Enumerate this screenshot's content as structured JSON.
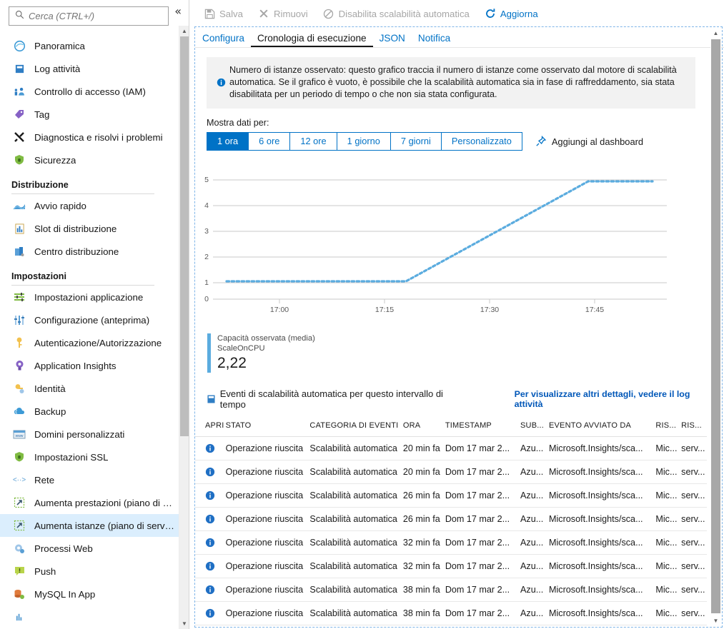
{
  "sidebar": {
    "search": {
      "placeholder": "Cerca (CTRL+/)",
      "value": "",
      "icon": "search-icon"
    },
    "collapse_label": "«",
    "items": [
      {
        "label": "Panoramica",
        "icon": "overview-icon",
        "selected": false
      },
      {
        "label": "Log attività",
        "icon": "activity-log-icon",
        "selected": false
      },
      {
        "label": "Controllo di accesso (IAM)",
        "icon": "access-control-icon",
        "selected": false
      },
      {
        "label": "Tag",
        "icon": "tag-icon",
        "selected": false
      },
      {
        "label": "Diagnostica e risolvi i problemi",
        "icon": "diagnose-icon",
        "selected": false
      },
      {
        "label": "Sicurezza",
        "icon": "security-shield-icon",
        "selected": false
      }
    ],
    "groups": [
      {
        "title": "Distribuzione",
        "items": [
          {
            "label": "Avvio rapido",
            "icon": "quickstart-icon",
            "selected": false
          },
          {
            "label": "Slot di distribuzione",
            "icon": "deployment-slots-icon",
            "selected": false
          },
          {
            "label": "Centro distribuzione",
            "icon": "deployment-center-icon",
            "selected": false
          }
        ]
      },
      {
        "title": "Impostazioni",
        "items": [
          {
            "label": "Impostazioni applicazione",
            "icon": "app-settings-icon",
            "selected": false
          },
          {
            "label": "Configurazione (anteprima)",
            "icon": "configuration-icon",
            "selected": false
          },
          {
            "label": "Autenticazione/Autorizzazione",
            "icon": "auth-key-icon",
            "selected": false
          },
          {
            "label": "Application Insights",
            "icon": "app-insights-icon",
            "selected": false
          },
          {
            "label": "Identità",
            "icon": "identity-key-icon",
            "selected": false
          },
          {
            "label": "Backup",
            "icon": "backup-cloud-icon",
            "selected": false
          },
          {
            "label": "Domini personalizzati",
            "icon": "custom-domains-icon",
            "selected": false
          },
          {
            "label": "Impostazioni SSL",
            "icon": "ssl-shield-icon",
            "selected": false
          },
          {
            "label": "Rete",
            "icon": "network-icon",
            "selected": false
          },
          {
            "label": "Aumenta prestazioni (piano di s...",
            "icon": "scale-up-icon",
            "selected": false
          },
          {
            "label": "Aumenta istanze (piano di servi...",
            "icon": "scale-out-icon",
            "selected": true
          },
          {
            "label": "Processi Web",
            "icon": "webjobs-icon",
            "selected": false
          },
          {
            "label": "Push",
            "icon": "push-icon",
            "selected": false
          },
          {
            "label": "MySQL In App",
            "icon": "mysql-icon",
            "selected": false
          }
        ]
      }
    ],
    "scrollbar": {
      "up_arrow": "▲",
      "down_arrow": "▼"
    }
  },
  "toolbar": {
    "items": [
      {
        "label": "Salva",
        "icon": "save-icon",
        "enabled": false
      },
      {
        "label": "Rimuovi",
        "icon": "discard-x-icon",
        "enabled": false
      },
      {
        "label": "Disabilita scalabilità automatica",
        "icon": "disable-circle-icon",
        "enabled": false
      },
      {
        "label": "Aggiorna",
        "icon": "refresh-icon",
        "enabled": true
      }
    ]
  },
  "tabs": [
    {
      "label": "Configura",
      "active": false
    },
    {
      "label": "Cronologia di esecuzione",
      "active": true
    },
    {
      "label": "JSON",
      "active": false
    },
    {
      "label": "Notifica",
      "active": false
    }
  ],
  "info_banner": {
    "icon": "info-icon",
    "text": "Numero di istanze osservato: questo grafico traccia il numero di istanze come osservato dal motore di scalabilità automatica. Se il grafico è vuoto, è possibile che la scalabilità automatica sia in fase di raffreddamento, sia stata disabilitata per un periodo di tempo o che non sia stata configurata."
  },
  "time_range": {
    "label": "Mostra dati per:",
    "options": [
      {
        "label": "1 ora",
        "active": true
      },
      {
        "label": "6 ore",
        "active": false
      },
      {
        "label": "12 ore",
        "active": false
      },
      {
        "label": "1 giorno",
        "active": false
      },
      {
        "label": "7 giorni",
        "active": false
      },
      {
        "label": "Personalizzato",
        "active": false
      }
    ],
    "pin": {
      "label": "Aggiungi al dashboard",
      "icon": "pin-icon"
    }
  },
  "chart_data": {
    "type": "line",
    "title": "",
    "xlabel": "",
    "ylabel": "",
    "ylim": [
      0,
      5
    ],
    "yticks": [
      0,
      1,
      2,
      3,
      4,
      5
    ],
    "xticks": [
      "17:00",
      "17:15",
      "17:30",
      "17:45"
    ],
    "grid": true,
    "legend_position": "below",
    "line_style": "dotted",
    "color": "#5bacdf",
    "series": [
      {
        "name": "Capacità osservata (media) ScaleOnCPU",
        "x": [
          "16:55",
          "17:00",
          "17:05",
          "17:10",
          "17:15",
          "17:18",
          "17:20",
          "17:25",
          "17:30",
          "17:35",
          "17:40",
          "17:43",
          "17:45",
          "17:50",
          "17:55"
        ],
        "values": [
          1,
          1,
          1,
          1,
          1,
          1,
          1.6,
          2.4,
          3.0,
          3.8,
          4.6,
          5,
          5,
          5,
          5
        ]
      }
    ],
    "legend": {
      "metric_label": "Capacità osservata (media)",
      "resource_label": "ScaleOnCPU",
      "value": "2,22",
      "color": "#5bacdf"
    }
  },
  "events": {
    "icon": "events-icon",
    "title": "Eventi di scalabilità automatica per questo intervallo di tempo",
    "link": "Per visualizzare altri dettagli, vedere il log attività",
    "columns": [
      "APRI",
      "STATO",
      "CATEGORIA DI EVENTI",
      "ORA",
      "TIMESTAMP",
      "SUB...",
      "EVENTO AVVIATO DA",
      "RIS...",
      "RIS..."
    ],
    "rows": [
      {
        "apri": "info-icon",
        "stato": "Operazione riuscita",
        "categoria": "Scalabilità automatica",
        "ora": "20 min fa",
        "timestamp": "Dom 17 mar 2...",
        "sub": "Azu...",
        "evento": "Microsoft.Insights/sca...",
        "ris1": "Mic...",
        "ris2": "serv..."
      },
      {
        "apri": "info-icon",
        "stato": "Operazione riuscita",
        "categoria": "Scalabilità automatica",
        "ora": "20 min fa",
        "timestamp": "Dom 17 mar 2...",
        "sub": "Azu...",
        "evento": "Microsoft.Insights/sca...",
        "ris1": "Mic...",
        "ris2": "serv..."
      },
      {
        "apri": "info-icon",
        "stato": "Operazione riuscita",
        "categoria": "Scalabilità automatica",
        "ora": "26 min fa",
        "timestamp": "Dom 17 mar 2...",
        "sub": "Azu...",
        "evento": "Microsoft.Insights/sca...",
        "ris1": "Mic...",
        "ris2": "serv..."
      },
      {
        "apri": "info-icon",
        "stato": "Operazione riuscita",
        "categoria": "Scalabilità automatica",
        "ora": "26 min fa",
        "timestamp": "Dom 17 mar 2...",
        "sub": "Azu...",
        "evento": "Microsoft.Insights/sca...",
        "ris1": "Mic...",
        "ris2": "serv..."
      },
      {
        "apri": "info-icon",
        "stato": "Operazione riuscita",
        "categoria": "Scalabilità automatica",
        "ora": "32 min fa",
        "timestamp": "Dom 17 mar 2...",
        "sub": "Azu...",
        "evento": "Microsoft.Insights/sca...",
        "ris1": "Mic...",
        "ris2": "serv..."
      },
      {
        "apri": "info-icon",
        "stato": "Operazione riuscita",
        "categoria": "Scalabilità automatica",
        "ora": "32 min fa",
        "timestamp": "Dom 17 mar 2...",
        "sub": "Azu...",
        "evento": "Microsoft.Insights/sca...",
        "ris1": "Mic...",
        "ris2": "serv..."
      },
      {
        "apri": "info-icon",
        "stato": "Operazione riuscita",
        "categoria": "Scalabilità automatica",
        "ora": "38 min fa",
        "timestamp": "Dom 17 mar 2...",
        "sub": "Azu...",
        "evento": "Microsoft.Insights/sca...",
        "ris1": "Mic...",
        "ris2": "serv..."
      },
      {
        "apri": "info-icon",
        "stato": "Operazione riuscita",
        "categoria": "Scalabilità automatica",
        "ora": "38 min fa",
        "timestamp": "Dom 17 mar 2...",
        "sub": "Azu...",
        "evento": "Microsoft.Insights/sca...",
        "ris1": "Mic...",
        "ris2": "serv..."
      }
    ]
  },
  "colors": {
    "accent": "#0072c6",
    "chart_line": "#5bacdf",
    "selected_row": "#dbeefd",
    "link": "#0057b8",
    "disabled": "#a6a6a6"
  }
}
